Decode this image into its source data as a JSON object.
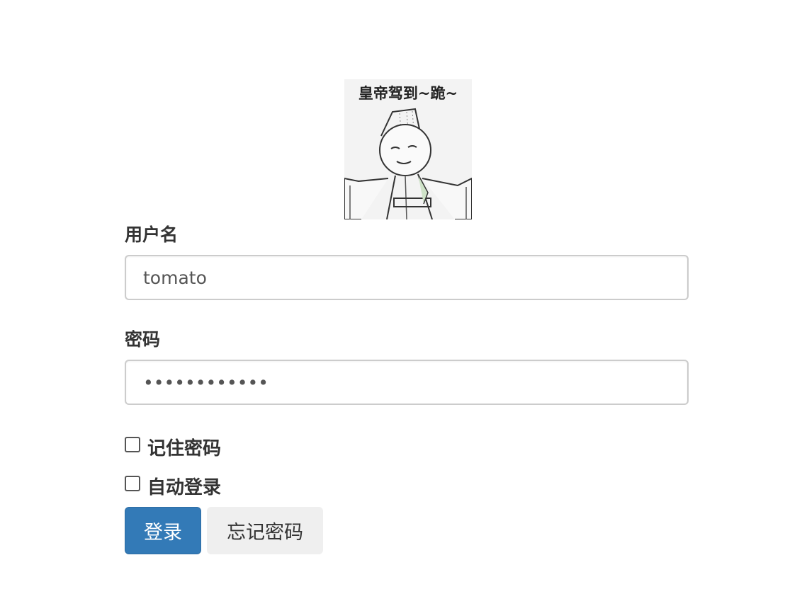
{
  "avatar": {
    "caption": "皇帝驾到~跪~"
  },
  "form": {
    "username_label": "用户名",
    "username_value": "tomato",
    "password_label": "密码",
    "password_value": "••••••••••••",
    "remember_label": "记住密码",
    "auto_login_label": "自动登录",
    "remember_checked": false,
    "auto_login_checked": false
  },
  "buttons": {
    "login": "登录",
    "forgot": "忘记密码"
  },
  "colors": {
    "primary": "#337ab7",
    "secondary": "#efefef",
    "text": "#333333",
    "border": "#cccccc"
  }
}
